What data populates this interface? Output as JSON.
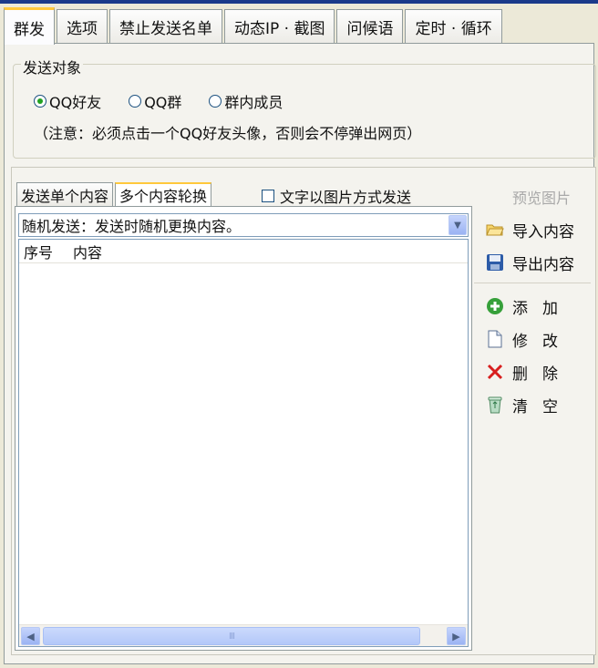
{
  "tabs": [
    "群发",
    "选项",
    "禁止发送名单",
    "动态IP · 截图",
    "问候语",
    "定时 · 循环"
  ],
  "target_group": {
    "title": "发送对象",
    "options": [
      "QQ好友",
      "QQ群",
      "群内成员"
    ],
    "selected": "QQ好友",
    "note": "（注意：必须点击一个QQ好友头像，否则会不停弹出网页）"
  },
  "content": {
    "subtabs": [
      "发送单个内容",
      "多个内容轮换"
    ],
    "active_subtab": "多个内容轮换",
    "image_send_checkbox": "文字以图片方式发送",
    "preview_link": "预览图片",
    "mode_select": "随机发送：发送时随机更换内容。",
    "columns": [
      "序号",
      "内容"
    ],
    "scroll_thumb_grip": "III"
  },
  "actions": {
    "import": "导入内容",
    "export": "导出内容",
    "add": "添加",
    "edit": "修改",
    "delete": "删除",
    "clear": "清空"
  },
  "colors": {
    "window_bg": "#ece9d8",
    "active_tab_accent": "#ffc83c",
    "radio_dot": "#21a121",
    "delete_icon": "#d81e1e"
  }
}
